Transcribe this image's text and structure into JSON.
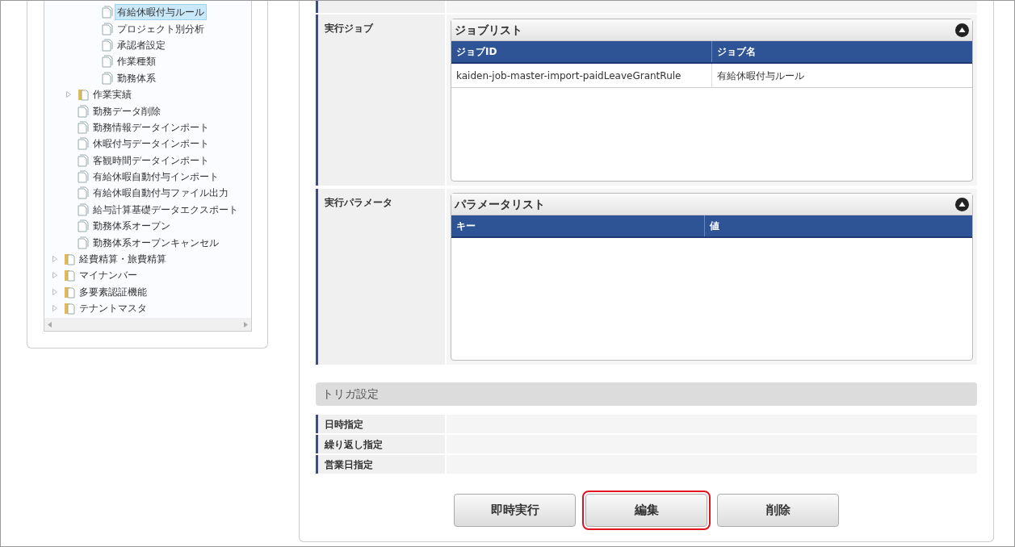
{
  "tree": {
    "items": [
      {
        "kind": "folder",
        "children": [
          {
            "kind": "folder",
            "children": [
              {
                "kind": "page",
                "label": "有給休暇付与ルール",
                "selected": true
              },
              {
                "kind": "page",
                "label": "プロジェクト別分析",
                "selected": false
              },
              {
                "kind": "page",
                "label": "承認者設定",
                "selected": false
              },
              {
                "kind": "page",
                "label": "作業種類",
                "selected": false
              },
              {
                "kind": "page",
                "label": "勤務体系",
                "selected": false
              }
            ]
          },
          {
            "kind": "folder",
            "label": "作業実績",
            "expanded": false
          },
          {
            "kind": "page",
            "label": "勤務データ削除",
            "selected": false
          },
          {
            "kind": "page",
            "label": "勤務情報データインポート",
            "selected": false
          },
          {
            "kind": "page",
            "label": "休暇付与データインポート",
            "selected": false
          },
          {
            "kind": "page",
            "label": "客観時間データインポート",
            "selected": false
          },
          {
            "kind": "page",
            "label": "有給休暇自動付与インポート",
            "selected": false
          },
          {
            "kind": "page",
            "label": "有給休暇自動付与ファイル出力",
            "selected": false
          },
          {
            "kind": "page",
            "label": "給与計算基礎データエクスポート",
            "selected": false
          },
          {
            "kind": "page",
            "label": "勤務体系オープン",
            "selected": false
          },
          {
            "kind": "page",
            "label": "勤務体系オープンキャンセル",
            "selected": false
          }
        ]
      },
      {
        "kind": "folder",
        "label": "経費精算・旅費精算",
        "expanded": false
      },
      {
        "kind": "folder",
        "label": "マイナンバー",
        "expanded": false
      },
      {
        "kind": "folder",
        "label": "多要素認証機能",
        "expanded": false
      },
      {
        "kind": "folder",
        "label": "テナントマスタ",
        "expanded": false
      }
    ]
  },
  "job_row": {
    "label": "実行ジョブ",
    "panel_title": "ジョブリスト",
    "columns": [
      "ジョブID",
      "ジョブ名"
    ],
    "rows": [
      [
        "kaiden-job-master-import-paidLeaveGrantRule",
        "有給休暇付与ルール"
      ]
    ]
  },
  "param_row": {
    "label": "実行パラメータ",
    "panel_title": "パラメータリスト",
    "columns": [
      "キー",
      "値"
    ]
  },
  "trigger": {
    "title": "トリガ設定",
    "rows": [
      "日時指定",
      "繰り返し指定",
      "営業日指定"
    ]
  },
  "buttons": [
    {
      "label": "即時実行",
      "highlighted": false
    },
    {
      "label": "編集",
      "highlighted": true
    },
    {
      "label": "削除",
      "highlighted": false
    }
  ]
}
